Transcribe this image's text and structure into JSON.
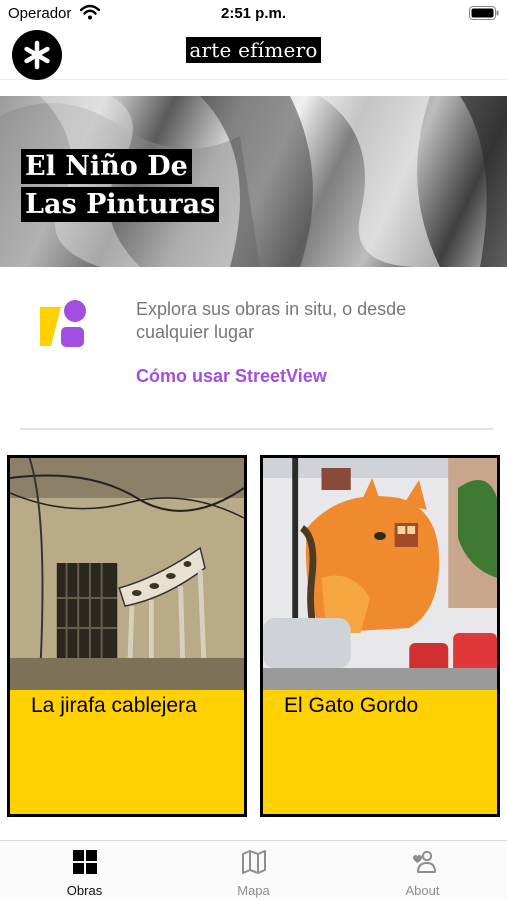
{
  "status_bar": {
    "carrier": "Operador",
    "time": "2:51 p.m.",
    "icons": [
      "wifi-icon",
      "battery-icon"
    ]
  },
  "header": {
    "logo_icon": "asterisk-logo-icon",
    "title": "arte efímero"
  },
  "hero": {
    "title_line1": "El Niño De",
    "title_line2": "Las Pinturas"
  },
  "info": {
    "icon": "shapes-icon",
    "description": "Explora sus obras in situ, o desde cualquier lugar",
    "link_label": "Cómo usar StreetView",
    "link_color": "#a24ee0"
  },
  "artworks": [
    {
      "title": "La jirafa cablejera",
      "image": "giraffe-mural-photo"
    },
    {
      "title": "El Gato Gordo",
      "image": "cat-mural-photo"
    }
  ],
  "card_color": "#ffd100",
  "tabbar": {
    "tabs": [
      {
        "label": "Obras",
        "icon": "grid-icon",
        "active": true
      },
      {
        "label": "Mapa",
        "icon": "map-icon",
        "active": false
      },
      {
        "label": "About",
        "icon": "person-heart-icon",
        "active": false
      }
    ]
  }
}
